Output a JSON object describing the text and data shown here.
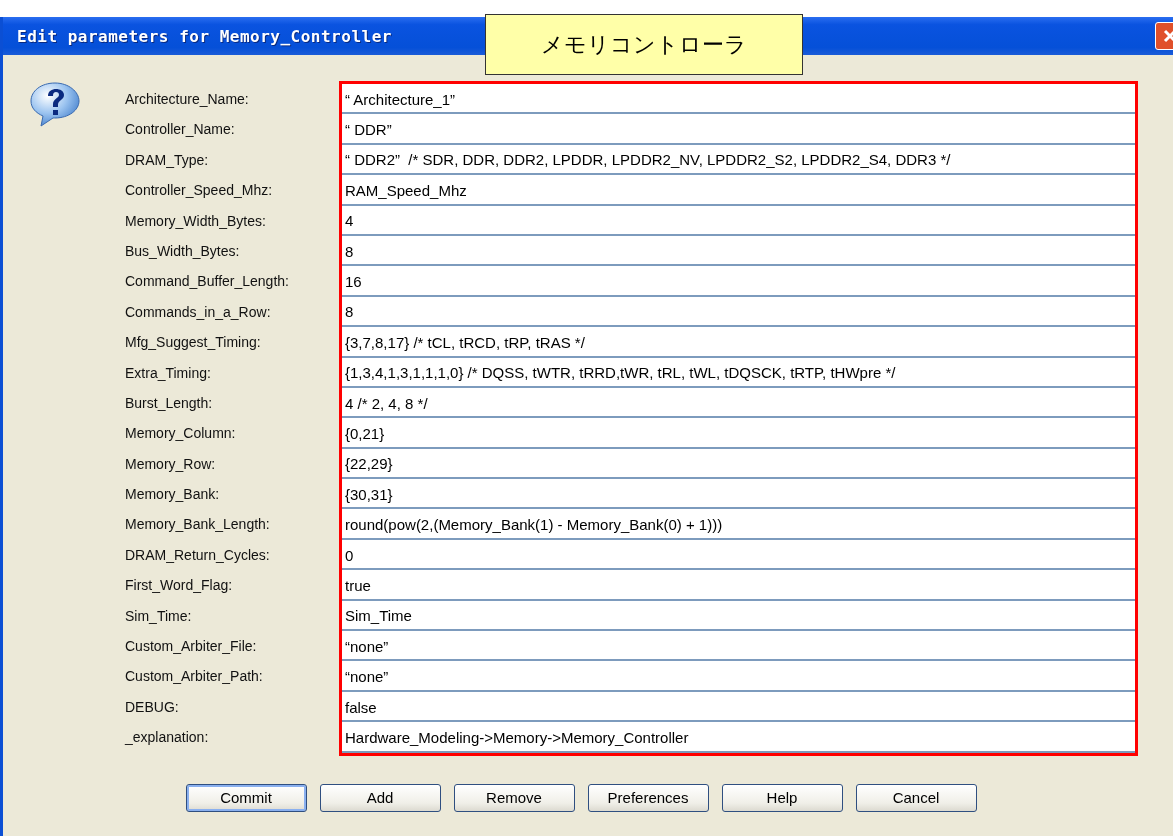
{
  "window": {
    "title": "Edit parameters for Memory_Controller"
  },
  "callout": {
    "text": "メモリコントローラ"
  },
  "parameters": [
    {
      "label": "Architecture_Name:",
      "value": "“ Architecture_1”"
    },
    {
      "label": "Controller_Name:",
      "value": "“ DDR”"
    },
    {
      "label": "DRAM_Type:",
      "value": "“ DDR2”  /* SDR, DDR, DDR2, LPDDR, LPDDR2_NV, LPDDR2_S2, LPDDR2_S4, DDR3 */"
    },
    {
      "label": "Controller_Speed_Mhz:",
      "value": "RAM_Speed_Mhz"
    },
    {
      "label": "Memory_Width_Bytes:",
      "value": "4"
    },
    {
      "label": "Bus_Width_Bytes:",
      "value": "8"
    },
    {
      "label": "Command_Buffer_Length:",
      "value": "16"
    },
    {
      "label": "Commands_in_a_Row:",
      "value": "8"
    },
    {
      "label": "Mfg_Suggest_Timing:",
      "value": "{3,7,8,17} /* tCL, tRCD, tRP, tRAS */"
    },
    {
      "label": "Extra_Timing:",
      "value": "{1,3,4,1,3,1,1,1,0} /* DQSS, tWTR, tRRD,tWR, tRL, tWL, tDQSCK, tRTP, tHWpre */"
    },
    {
      "label": "Burst_Length:",
      "value": "4 /* 2, 4, 8 */"
    },
    {
      "label": "Memory_Column:",
      "value": "{0,21}"
    },
    {
      "label": "Memory_Row:",
      "value": "{22,29}"
    },
    {
      "label": "Memory_Bank:",
      "value": "{30,31}"
    },
    {
      "label": "Memory_Bank_Length:",
      "value": "round(pow(2,(Memory_Bank(1) - Memory_Bank(0) + 1)))"
    },
    {
      "label": "DRAM_Return_Cycles:",
      "value": "0"
    },
    {
      "label": "First_Word_Flag:",
      "value": "true"
    },
    {
      "label": "Sim_Time:",
      "value": "Sim_Time"
    },
    {
      "label": "Custom_Arbiter_File:",
      "value": "“none”"
    },
    {
      "label": "Custom_Arbiter_Path:",
      "value": "“none”"
    },
    {
      "label": "DEBUG:",
      "value": "false"
    },
    {
      "label": "_explanation:",
      "value": "Hardware_Modeling->Memory->Memory_Controller"
    }
  ],
  "buttons": [
    {
      "label": "Commit",
      "default": true
    },
    {
      "label": "Add",
      "default": false
    },
    {
      "label": "Remove",
      "default": false
    },
    {
      "label": "Preferences",
      "default": false
    },
    {
      "label": "Help",
      "default": false
    },
    {
      "label": "Cancel",
      "default": false
    }
  ]
}
